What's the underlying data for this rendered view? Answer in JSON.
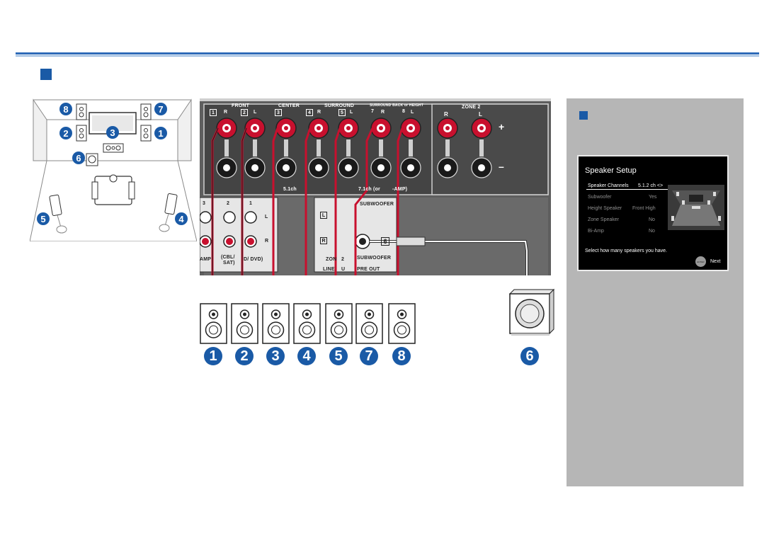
{
  "colors": {
    "accent": "#1a5aa6",
    "cable_red": "#c8102e",
    "panel_gray": "#5a5a5a",
    "side_gray": "#b6b6b6"
  },
  "room_layout": {
    "labels": [
      "8",
      "7",
      "2",
      "3",
      "1",
      "6",
      "5",
      "4"
    ]
  },
  "back_panel": {
    "groups": {
      "front": "FRONT",
      "center": "CENTER",
      "surround": "SURROUND",
      "surround_back": "SURROUND BACK or HEIGHT",
      "zone2": "ZONE 2"
    },
    "terminals": [
      {
        "num": "1",
        "ch": "R"
      },
      {
        "num": "2",
        "ch": "L"
      },
      {
        "num": "3",
        "ch": ""
      },
      {
        "num": "4",
        "ch": "R"
      },
      {
        "num": "5",
        "ch": "L"
      },
      {
        "num": "7",
        "ch": "R"
      },
      {
        "num": "8",
        "ch": "L"
      }
    ],
    "zone2_channels": [
      "R",
      "L"
    ],
    "plus": "+",
    "minus": "–",
    "label_51": "5.1ch",
    "label_71": "7.1ch (or",
    "label_amp": "-AMP)",
    "input_labels": {
      "num3": "3",
      "num2": "2",
      "num1": "1",
      "L": "L",
      "R": "R",
      "amp": "AMP",
      "cbl": "(CBL/",
      "sat": "SAT)",
      "dvd": "D/ DVD)"
    },
    "line_out": {
      "L": "L",
      "R": "R",
      "zone": "ZON",
      "two": "2",
      "line": "LINE",
      "u": "U"
    },
    "subwoofer_top": "SUBWOOFER",
    "subwoofer_bottom": "SUBWOOFER",
    "subwoofer_num": "6",
    "pre_out": "PRE OUT"
  },
  "speakers": {
    "numbers": [
      "1",
      "2",
      "3",
      "4",
      "5",
      "7",
      "8"
    ],
    "subwoofer_number": "6"
  },
  "setup_screen": {
    "title": "Speaker Setup",
    "rows": [
      {
        "label": "Speaker Channels",
        "value": "5.1.2 ch <>"
      },
      {
        "label": "Subwoofer",
        "value": "Yes"
      },
      {
        "label": "Height Speaker",
        "value": "Front High"
      },
      {
        "label": "Zone Speaker",
        "value": "No"
      },
      {
        "label": "Bi-Amp",
        "value": "No"
      }
    ],
    "footer": "Select how many speakers you have.",
    "enter_label": "ENTER",
    "next": "Next"
  }
}
